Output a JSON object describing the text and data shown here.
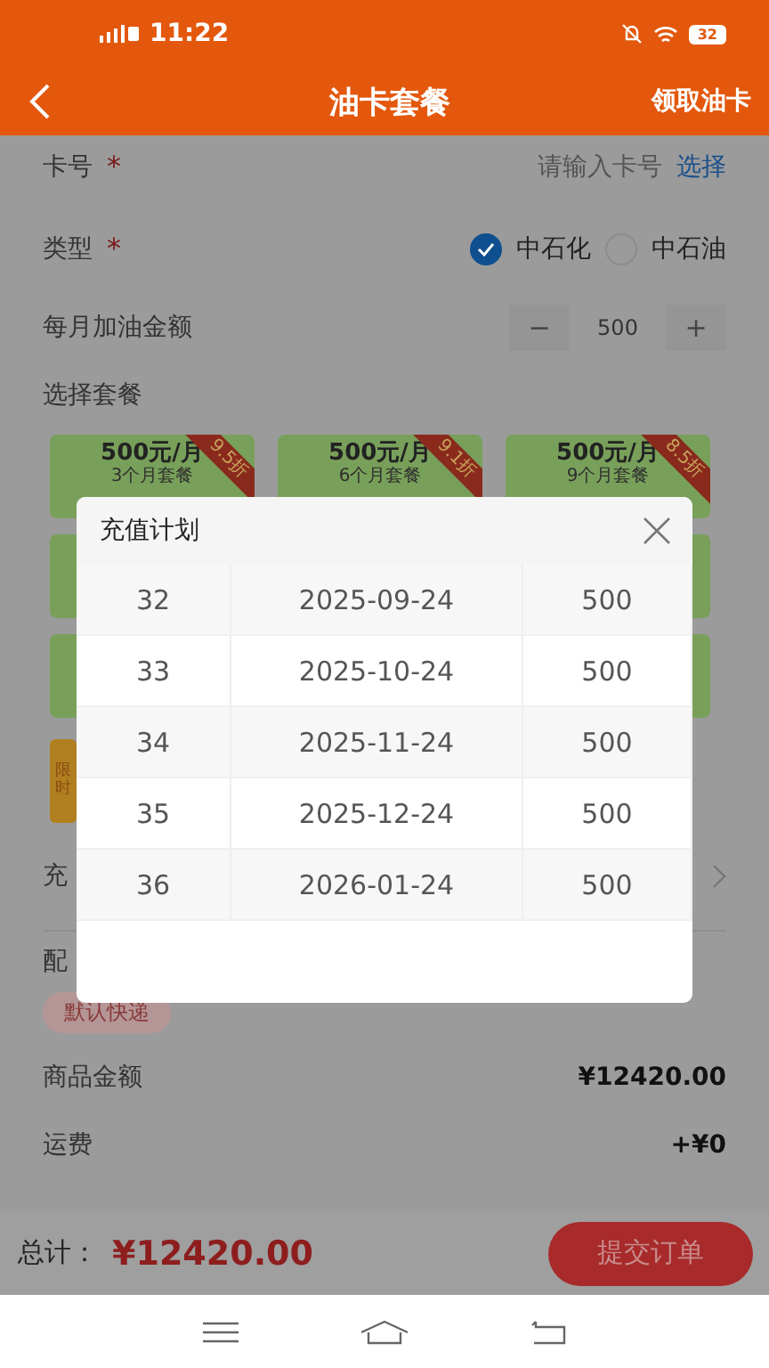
{
  "status_bar": {
    "time": "11:22",
    "battery": "32"
  },
  "header": {
    "title": "油卡套餐",
    "action": "领取油卡"
  },
  "form": {
    "card_number": {
      "label": "卡号",
      "required_mark": "*",
      "placeholder": "请输入卡号",
      "action": "选择"
    },
    "type": {
      "label": "类型",
      "required_mark": "*",
      "options": [
        {
          "label": "中石化",
          "selected": true
        },
        {
          "label": "中石油",
          "selected": false
        }
      ]
    },
    "monthly_amount": {
      "label": "每月加油金额",
      "minus": "−",
      "value": "500",
      "plus": "+"
    },
    "packages_label": "选择套餐",
    "packages": [
      {
        "kind": "shown",
        "price": "500元/月",
        "term": "3个月套餐",
        "discount": "9.5折"
      },
      {
        "kind": "shown",
        "price": "500元/月",
        "term": "6个月套餐",
        "discount": "9.1折"
      },
      {
        "kind": "shown",
        "price": "500元/月",
        "term": "9个月套餐",
        "discount": "8.5折"
      },
      {
        "kind": "covered"
      },
      {
        "kind": "covered"
      },
      {
        "kind": "covered"
      },
      {
        "kind": "covered"
      }
    ],
    "promo_tag": "限时",
    "plan_row_label": "充",
    "delivery_label": "配",
    "delivery_tag": "默认快递",
    "goods_amount": {
      "label": "商品金额",
      "value": "¥12420.00"
    },
    "shipping": {
      "label": "运费",
      "value": "+¥0"
    }
  },
  "footer": {
    "total_label": "总计：",
    "total": "¥12420.00",
    "submit": "提交订单"
  },
  "dialog": {
    "title": "充值计划",
    "rows": [
      {
        "index": "32",
        "date": "2025-09-24",
        "amount": "500"
      },
      {
        "index": "33",
        "date": "2025-10-24",
        "amount": "500"
      },
      {
        "index": "34",
        "date": "2025-11-24",
        "amount": "500"
      },
      {
        "index": "35",
        "date": "2025-12-24",
        "amount": "500"
      },
      {
        "index": "36",
        "date": "2026-01-24",
        "amount": "500"
      }
    ]
  }
}
